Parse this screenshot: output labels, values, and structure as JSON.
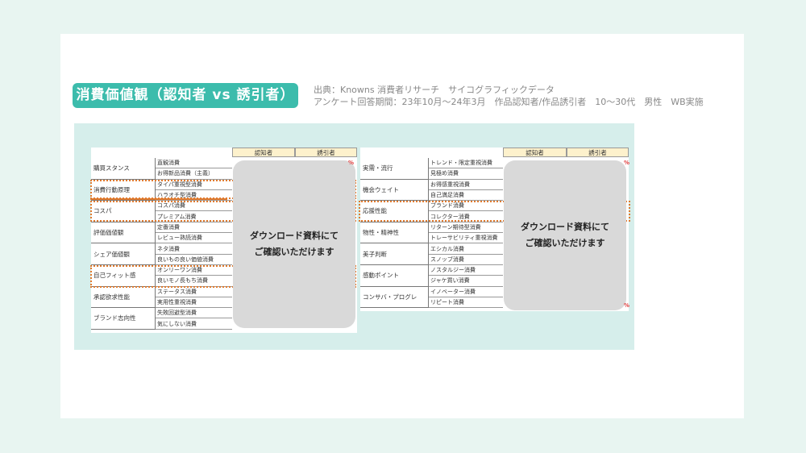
{
  "title": "消費価値観（認知者 vs 誘引者）",
  "source_line1": "出典：Knowns 消費者リサーチ　サイコグラフィックデータ",
  "source_line2": "アンケート回答期間：23年10月〜24年3月　作品認知者/作品誘引者　10〜30代　男性　WB実施",
  "overlay_text_line1": "ダウンロード資料にて",
  "overlay_text_line2": "ご確認いただけます",
  "header": {
    "col1": "認知者",
    "col2": "誘引者"
  },
  "left_table": [
    {
      "group": "購買スタンス",
      "items": [
        "直観消費",
        "お得新品消費（主義）"
      ]
    },
    {
      "group": "消費行動原理",
      "items": [
        "タイパ重視型消費",
        "ハラオチ型消費"
      ]
    },
    {
      "group": "コスパ",
      "items": [
        "コスパ消費",
        "プレミアム消費"
      ]
    },
    {
      "group": "評価価値観",
      "items": [
        "定番消費",
        "レビュー熟読消費"
      ]
    },
    {
      "group": "シェア価値観",
      "items": [
        "ネタ消費",
        "良いもの良い価値消費"
      ]
    },
    {
      "group": "自己フィット感",
      "items": [
        "オンリーワン消費",
        "良いモノ長もち消費"
      ]
    },
    {
      "group": "承認欲求性能",
      "items": [
        "ステータス消費",
        "実用性重視消費"
      ]
    },
    {
      "group": "ブランド志向性",
      "items": [
        "失敗回避型消費",
        "気にしない消費"
      ]
    }
  ],
  "right_table": [
    {
      "group": "実需・流行",
      "items": [
        "トレンド・限定重視消費",
        "見極め消費"
      ]
    },
    {
      "group": "機会ウェイト",
      "items": [
        "お得感重視消費",
        "自己満足消費"
      ]
    },
    {
      "group": "応援性能",
      "items": [
        "ブランド消費",
        "コレクター消費"
      ]
    },
    {
      "group": "物性・精神性",
      "items": [
        "リターン期待型消費",
        "トレーサビリティ重視消費"
      ]
    },
    {
      "group": "美子判断",
      "items": [
        "エシカル消費",
        "スノッブ消費"
      ]
    },
    {
      "group": "感動ポイント",
      "items": [
        "ノスタルジー消費",
        "ジャケ買い消費"
      ]
    },
    {
      "group": "コンサバ・プログレ",
      "items": [
        "イノベーター消費",
        "リピート消費"
      ]
    }
  ],
  "pct_marks": [
    "%",
    "%",
    "%"
  ],
  "colors": {
    "accent": "#3cbcac",
    "panel": "#d6eeeb",
    "highlight": "#e07a2e",
    "header_fill": "#fdf1cc"
  }
}
